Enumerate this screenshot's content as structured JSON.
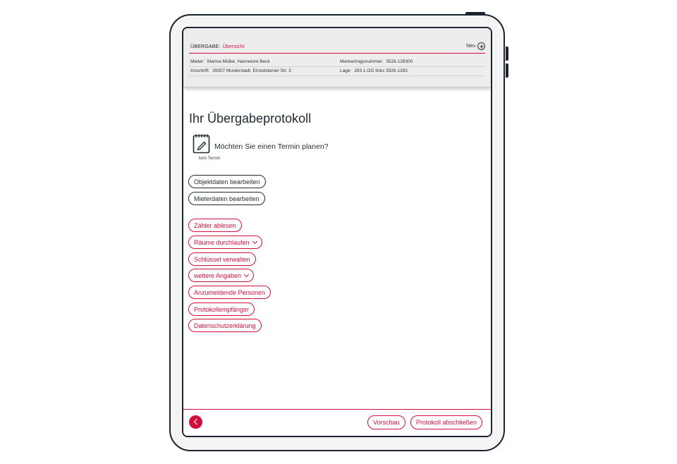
{
  "header": {
    "section": "ÜBERGABE:",
    "current": "Übersicht",
    "new_label": "Neu",
    "mieter_label": "Mieter:",
    "mieter_value": "Marina Müller, Hannelore Beck",
    "anschrift_label": "Anschrift:",
    "anschrift_value": "39307 Musterstadt, Einzelsteiner Str. 3",
    "vertrag_label": "Mietvertragsnummer:",
    "vertrag_value": "3526.128300",
    "lage_label": "Lage:",
    "lage_value": "283 1.OG links 3526.1283"
  },
  "main": {
    "title": "Ihr Übergabeprotokoll",
    "termin_question": "Möchten Sie einen Termin planen?",
    "termin_status": "kein Termin",
    "buttons": {
      "objektdaten": "Objektdaten bearbeiten",
      "mieterdaten": "Mieterdaten bearbeiten",
      "zaehler": "Zähler  ablesen",
      "raeume": "Räume durchlaufen",
      "schluessel": "Schlüssel verwalten",
      "weitere": "weitere Angaben",
      "anzumeldende": "Anzumeldende Personen",
      "protokollempfaenger": "Protokollempfänger",
      "datenschutz": "Datenschutzerklärung"
    }
  },
  "footer": {
    "preview": "Vorschau",
    "finish": "Protokoll abschließen"
  },
  "icons": {
    "plus": "plus-circle-icon",
    "notepad": "notepad-pen-icon",
    "chevron_down": "chevron-down-icon",
    "back": "chevron-left-icon"
  },
  "colors": {
    "accent": "#d0103a",
    "text": "#1f2a33",
    "frame": "#1c2430",
    "header_bg": "#ededee"
  }
}
